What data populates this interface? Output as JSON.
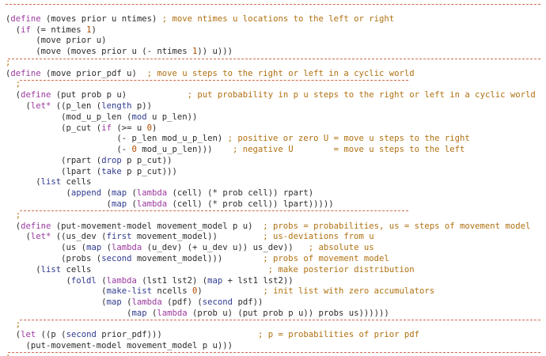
{
  "code": {
    "lines": [
      [
        {
          "t": ""
        }
      ],
      [
        {
          "t": "(",
          "s": "p"
        },
        {
          "t": "define",
          "s": "k"
        },
        {
          "t": " (moves prior u ntimes) ",
          "s": "p"
        },
        {
          "t": "; move ntimes u locations to the left or right",
          "s": "c"
        }
      ],
      [
        {
          "t": "  (",
          "s": "p"
        },
        {
          "t": "if",
          "s": "k"
        },
        {
          "t": " (= ntimes ",
          "s": "p"
        },
        {
          "t": "1",
          "s": "n"
        },
        {
          "t": ")",
          "s": "p"
        }
      ],
      [
        {
          "t": "      (move prior u)",
          "s": "p"
        }
      ],
      [
        {
          "t": "      (move (moves prior u (- ntimes ",
          "s": "p"
        },
        {
          "t": "1",
          "s": "n"
        },
        {
          "t": ")) u)))",
          "s": "p"
        }
      ],
      [
        {
          "t": ";",
          "s": "c"
        }
      ],
      [
        {
          "t": "(",
          "s": "p"
        },
        {
          "t": "define",
          "s": "k"
        },
        {
          "t": " (move prior_pdf u)  ",
          "s": "p"
        },
        {
          "t": "; move u steps to the right or left in a cyclic world",
          "s": "c"
        }
      ],
      [
        {
          "t": "  ;",
          "s": "c"
        }
      ],
      [
        {
          "t": "  (",
          "s": "p"
        },
        {
          "t": "define",
          "s": "k"
        },
        {
          "t": " (put prob p u)            ",
          "s": "p"
        },
        {
          "t": "; put probability in p u steps to the right or left in a cyclic world",
          "s": "c"
        }
      ],
      [
        {
          "t": "    (",
          "s": "p"
        },
        {
          "t": "let*",
          "s": "k"
        },
        {
          "t": " ((p_len (",
          "s": "p"
        },
        {
          "t": "length",
          "s": "b"
        },
        {
          "t": " p))",
          "s": "p"
        }
      ],
      [
        {
          "t": "           (mod_u_p_len (",
          "s": "p"
        },
        {
          "t": "mod",
          "s": "b"
        },
        {
          "t": " u p_len))",
          "s": "p"
        }
      ],
      [
        {
          "t": "           (p_cut (",
          "s": "p"
        },
        {
          "t": "if",
          "s": "k"
        },
        {
          "t": " (>= u ",
          "s": "p"
        },
        {
          "t": "0",
          "s": "n"
        },
        {
          "t": ")",
          "s": "p"
        }
      ],
      [
        {
          "t": "                      (- p_len mod_u_p_len) ",
          "s": "p"
        },
        {
          "t": "; positive or zero U = move u steps to the right",
          "s": "c"
        }
      ],
      [
        {
          "t": "                      (- ",
          "s": "p"
        },
        {
          "t": "0",
          "s": "n"
        },
        {
          "t": " mod_u_p_len)))    ",
          "s": "p"
        },
        {
          "t": "; negative U        = move u steps to the left",
          "s": "c"
        }
      ],
      [
        {
          "t": "           (rpart (",
          "s": "p"
        },
        {
          "t": "drop",
          "s": "b"
        },
        {
          "t": " p p_cut))",
          "s": "p"
        }
      ],
      [
        {
          "t": "           (lpart (",
          "s": "p"
        },
        {
          "t": "take",
          "s": "b"
        },
        {
          "t": " p p_cut)))",
          "s": "p"
        }
      ],
      [
        {
          "t": "      (",
          "s": "p"
        },
        {
          "t": "list",
          "s": "b"
        },
        {
          "t": " cells",
          "s": "p"
        }
      ],
      [
        {
          "t": "            (",
          "s": "p"
        },
        {
          "t": "append",
          "s": "b"
        },
        {
          "t": " (",
          "s": "p"
        },
        {
          "t": "map",
          "s": "b"
        },
        {
          "t": " (",
          "s": "p"
        },
        {
          "t": "lambda",
          "s": "k"
        },
        {
          "t": " (cell) (* prob cell)) rpart)",
          "s": "p"
        }
      ],
      [
        {
          "t": "                    (",
          "s": "p"
        },
        {
          "t": "map",
          "s": "b"
        },
        {
          "t": " (",
          "s": "p"
        },
        {
          "t": "lambda",
          "s": "k"
        },
        {
          "t": " (cell) (* prob cell)) lpart)))))",
          "s": "p"
        }
      ],
      [
        {
          "t": "  ;",
          "s": "c"
        }
      ],
      [
        {
          "t": "  (",
          "s": "p"
        },
        {
          "t": "define",
          "s": "k"
        },
        {
          "t": " (put-movement-model movement_model p u)  ",
          "s": "p"
        },
        {
          "t": "; probs = probabilities, us = steps of movement model",
          "s": "c"
        }
      ],
      [
        {
          "t": "    (",
          "s": "p"
        },
        {
          "t": "let*",
          "s": "k"
        },
        {
          "t": " ((us_dev (",
          "s": "p"
        },
        {
          "t": "first",
          "s": "b"
        },
        {
          "t": " movement_model))         ",
          "s": "p"
        },
        {
          "t": "; us-deviations from u",
          "s": "c"
        }
      ],
      [
        {
          "t": "           (us (",
          "s": "p"
        },
        {
          "t": "map",
          "s": "b"
        },
        {
          "t": " (",
          "s": "p"
        },
        {
          "t": "lambda",
          "s": "k"
        },
        {
          "t": " (u_dev) (+ u_dev u)) us_dev))   ",
          "s": "p"
        },
        {
          "t": "; absolute us",
          "s": "c"
        }
      ],
      [
        {
          "t": "           (probs (",
          "s": "p"
        },
        {
          "t": "second",
          "s": "b"
        },
        {
          "t": " movement_model)))        ",
          "s": "p"
        },
        {
          "t": "; probs of movement model",
          "s": "c"
        }
      ],
      [
        {
          "t": "      (",
          "s": "p"
        },
        {
          "t": "list",
          "s": "b"
        },
        {
          "t": " cells                                   ",
          "s": "p"
        },
        {
          "t": "; make posterior distribution",
          "s": "c"
        }
      ],
      [
        {
          "t": "            (",
          "s": "p"
        },
        {
          "t": "foldl",
          "s": "b"
        },
        {
          "t": " (",
          "s": "p"
        },
        {
          "t": "lambda",
          "s": "k"
        },
        {
          "t": " (lst1 lst2) (",
          "s": "p"
        },
        {
          "t": "map",
          "s": "b"
        },
        {
          "t": " + lst1 lst2))",
          "s": "p"
        }
      ],
      [
        {
          "t": "                   (",
          "s": "p"
        },
        {
          "t": "make-list",
          "s": "b"
        },
        {
          "t": " ncells ",
          "s": "p"
        },
        {
          "t": "0",
          "s": "n"
        },
        {
          "t": ")            ",
          "s": "p"
        },
        {
          "t": "; init list with zero accumulators",
          "s": "c"
        }
      ],
      [
        {
          "t": "                   (",
          "s": "p"
        },
        {
          "t": "map",
          "s": "b"
        },
        {
          "t": " (",
          "s": "p"
        },
        {
          "t": "lambda",
          "s": "k"
        },
        {
          "t": " (pdf) (",
          "s": "p"
        },
        {
          "t": "second",
          "s": "b"
        },
        {
          "t": " pdf))",
          "s": "p"
        }
      ],
      [
        {
          "t": "                        (",
          "s": "p"
        },
        {
          "t": "map",
          "s": "b"
        },
        {
          "t": " (",
          "s": "p"
        },
        {
          "t": "lambda",
          "s": "k"
        },
        {
          "t": " (prob u) (put prob p u)) probs us))))))",
          "s": "p"
        }
      ],
      [
        {
          "t": "  ;",
          "s": "c"
        }
      ],
      [
        {
          "t": "  (",
          "s": "p"
        },
        {
          "t": "let",
          "s": "k"
        },
        {
          "t": " ((p (",
          "s": "p"
        },
        {
          "t": "second",
          "s": "b"
        },
        {
          "t": " prior_pdf)))                   ",
          "s": "p"
        },
        {
          "t": "; p = probabilities of prior pdf",
          "s": "c"
        }
      ],
      [
        {
          "t": "    (put-movement-model movement_model p u)))",
          "s": "p"
        }
      ],
      [
        {
          "t": ";",
          "s": "c"
        }
      ]
    ]
  }
}
